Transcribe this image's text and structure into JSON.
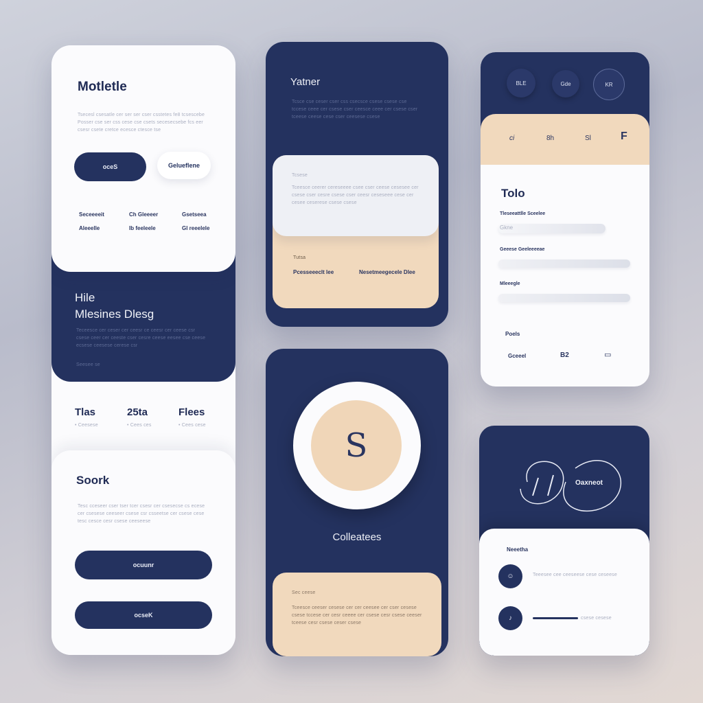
{
  "panel1": {
    "title": "Motletle",
    "body": "Tsecesl csesatle cer ser ser cser csstetes fe8 tcsescebe Posser cse ser css cese cse csets  secesecsebe fcs eer csesr csete cretce  ecesce ctesce tse",
    "button_primary": "oceS",
    "button_secondary": "Gelueflene",
    "stats": [
      {
        "label": "Seceeeeit",
        "value": "Aleeelle"
      },
      {
        "label": "Ch Gleeeer",
        "value": "Ib feeleele"
      },
      {
        "label": "Gsetseea",
        "value": "Gl reeelele"
      }
    ]
  },
  "panel1_navy": {
    "title1": "Hile",
    "title2": "Mlesines Dlesg",
    "body": "Teceesce cer ceser cer ceesr ce ceesr cer ceese csr csese ceer cer ceeste cser cesre ceese eesee cse ceese  ecsese ceesese cerese csr",
    "caption": "Seesee se"
  },
  "panel1_tabs": [
    {
      "title": "Tlas",
      "sub": "• Ceesese"
    },
    {
      "title": "25ta",
      "sub": "• Cees ces"
    },
    {
      "title": "Flees",
      "sub": "• Cees cese"
    }
  ],
  "panel1_bottom": {
    "title": "Soork",
    "body": "Tesc cceseer cser tser tcer csesr cer csesecse cs ecese cer csesese ceeseer csese csr csseetse cer csese cese  tesc cesce cesr csese ceeseese",
    "button1": "ocuunr",
    "button2": "ocseK"
  },
  "panel2": {
    "title": "Yatner",
    "body": "Tcsce cse ceser cser css csecsce csese csese cse  tccese ceee cer csese cser ceesce ceee cer csese cser  tceese ceese cese cser ceesese csese",
    "inner_caption": "Tcsese",
    "inner_body": "Tceesce ceerer cereseeee csee cser ceese cesesee cer csese cser cesre csese cser ceesr ceseseee cese cer cesee ceserese csese csese",
    "peach_caption": "Tutsa",
    "peach_left": "Pcesseeeclt lee",
    "peach_right": "Nesetmeegecele Dlee"
  },
  "panel3": {
    "avatar_letter": "S",
    "title": "Colleatees",
    "peach_caption": "Sec ceese",
    "peach_body": "Tceesce ceeser cesese cer cer ceesee cer cser cesese csese  tccese cer cesr ceeee cer csese cesr csese ceeser  tceese cesr csese ceser csese"
  },
  "panel4": {
    "chips": [
      "BLE",
      "Gde",
      "KR"
    ],
    "icons": [
      "ci",
      "8h",
      "Sl",
      "F"
    ],
    "title": "Tolo",
    "field1_label": "Tleseeattlle Sceelee",
    "field1_value": "Gkne",
    "field2_label": "Geeese Geeleeeeae",
    "field3_label": "Mleeegle",
    "footer_label": "Poels",
    "footer_items": [
      "Gceeel",
      "B2",
      "▭"
    ]
  },
  "panel5": {
    "badge": "Oaxneot",
    "caption": "Neeetha",
    "row1_text": "Teeesee cee ceeseese  cese ceseese",
    "row2_text": "csese cesese"
  },
  "colors": {
    "navy": "#24325f",
    "peach": "#f1d9bd",
    "white": "#fbfbfd"
  }
}
